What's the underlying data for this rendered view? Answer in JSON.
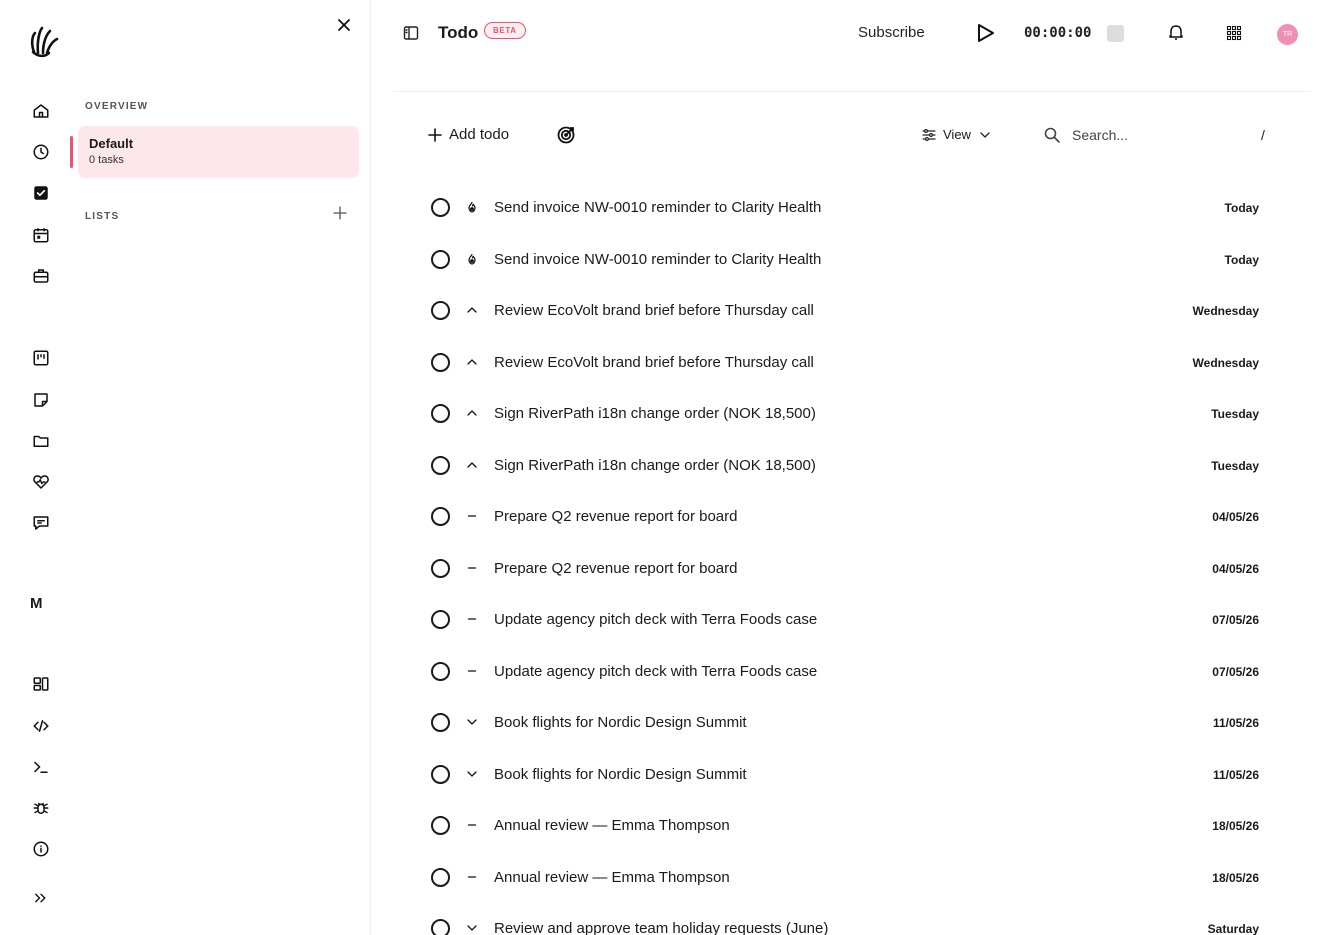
{
  "rail": {
    "workspace_letter": "M",
    "icons": [
      "home-icon",
      "clock-icon",
      "checkbox-icon",
      "calendar-icon",
      "briefcase-icon",
      "board-icon",
      "note-icon",
      "folder-icon",
      "heart-pulse-icon",
      "chat-icon",
      "dashboard-icon",
      "code-icon",
      "terminal-icon",
      "bug-icon",
      "info-icon",
      "chevrons-right-icon"
    ]
  },
  "panel": {
    "overview_label": "OVERVIEW",
    "default_list": {
      "name": "Default",
      "count": "0 tasks"
    },
    "lists_label": "LISTS"
  },
  "header": {
    "title": "Todo",
    "badge": "BETA",
    "subscribe": "Subscribe",
    "timer": "00:00:00",
    "avatar_initials": "TR"
  },
  "toolbar": {
    "add_label": "Add todo",
    "view_label": "View",
    "search_placeholder": "Search...",
    "search_shortcut": "/"
  },
  "todos": [
    {
      "text": "Send invoice NW-0010 reminder to Clarity Health",
      "date": "Today",
      "priority": "urgent"
    },
    {
      "text": "Send invoice NW-0010 reminder to Clarity Health",
      "date": "Today",
      "priority": "urgent"
    },
    {
      "text": "Review EcoVolt brand brief before Thursday call",
      "date": "Wednesday",
      "priority": "high"
    },
    {
      "text": "Review EcoVolt brand brief before Thursday call",
      "date": "Wednesday",
      "priority": "high"
    },
    {
      "text": "Sign RiverPath i18n change order (NOK 18,500)",
      "date": "Tuesday",
      "priority": "high"
    },
    {
      "text": "Sign RiverPath i18n change order (NOK 18,500)",
      "date": "Tuesday",
      "priority": "high"
    },
    {
      "text": "Prepare Q2 revenue report for board",
      "date": "04/05/26",
      "priority": "medium"
    },
    {
      "text": "Prepare Q2 revenue report for board",
      "date": "04/05/26",
      "priority": "medium"
    },
    {
      "text": "Update agency pitch deck with Terra Foods case",
      "date": "07/05/26",
      "priority": "medium"
    },
    {
      "text": "Update agency pitch deck with Terra Foods case",
      "date": "07/05/26",
      "priority": "medium"
    },
    {
      "text": "Book flights for Nordic Design Summit",
      "date": "11/05/26",
      "priority": "low"
    },
    {
      "text": "Book flights for Nordic Design Summit",
      "date": "11/05/26",
      "priority": "low"
    },
    {
      "text": "Annual review — Emma Thompson",
      "date": "18/05/26",
      "priority": "medium"
    },
    {
      "text": "Annual review — Emma Thompson",
      "date": "18/05/26",
      "priority": "medium"
    },
    {
      "text": "Review and approve team holiday requests (June)",
      "date": "Saturday",
      "priority": "low"
    }
  ]
}
